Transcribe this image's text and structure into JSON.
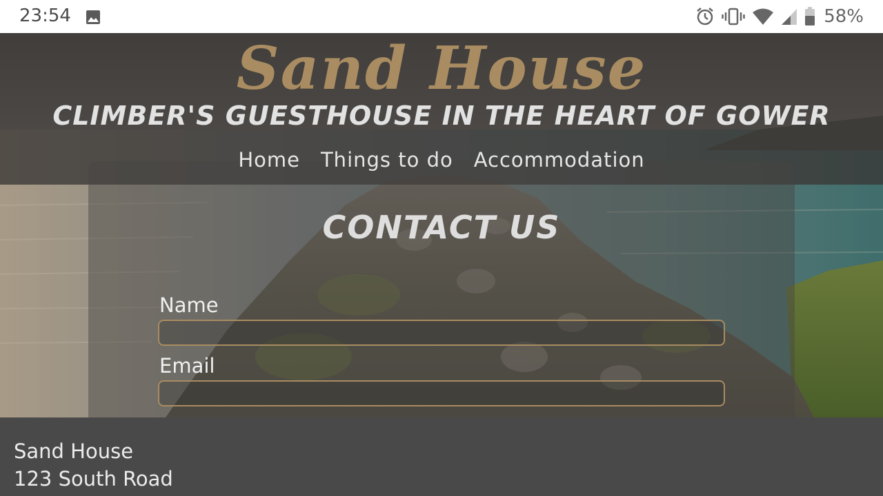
{
  "status_bar": {
    "time": "23:54",
    "battery_percent": "58%",
    "icons": [
      "photo-icon",
      "alarm-icon",
      "vibrate-icon",
      "wifi-icon",
      "cell-signal-icon",
      "battery-icon"
    ]
  },
  "header": {
    "site_title": "Sand House",
    "tagline": "CLIMBER'S GUESTHOUSE IN THE HEART OF GOWER",
    "title_color": "#a98c61"
  },
  "nav": {
    "items": [
      {
        "label": "Home"
      },
      {
        "label": "Things to do"
      },
      {
        "label": "Accommodation"
      }
    ]
  },
  "contact": {
    "heading": "CONTACT US",
    "name_label": "Name",
    "name_value": "",
    "email_label": "Email",
    "email_value": ""
  },
  "footer": {
    "line1": "Sand House",
    "line2": "123 South Road"
  },
  "colors": {
    "accent": "#a98c61",
    "overlay": "#3a3736",
    "footer_bg": "#4a4949"
  }
}
